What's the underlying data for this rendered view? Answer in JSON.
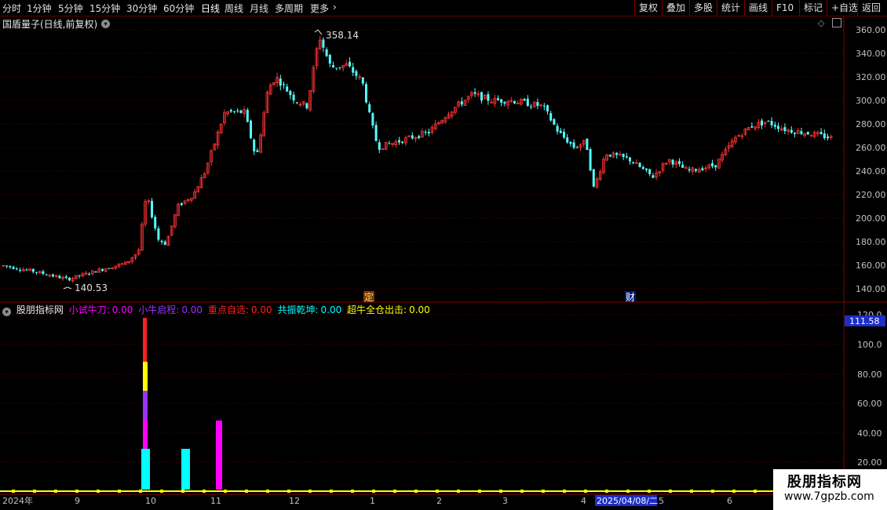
{
  "toolbar": {
    "periods": [
      "分时",
      "1分钟",
      "5分钟",
      "15分钟",
      "30分钟",
      "60分钟",
      "日线",
      "周线",
      "月线",
      "多周期",
      "更多"
    ],
    "active_period": "日线",
    "more_arrow": "›",
    "right_buttons": [
      "复权",
      "叠加",
      "多股",
      "统计",
      "画线",
      "F10",
      "标记",
      "+自选",
      "返回"
    ]
  },
  "stock": {
    "title": "国盾量子(日线,前复权)",
    "high_label": "358.14",
    "low_label": "140.53",
    "event_marks": [
      "定",
      "财"
    ]
  },
  "price_axis": {
    "ticks": [
      "360.00",
      "340.00",
      "320.00",
      "300.00",
      "280.00",
      "260.00",
      "240.00",
      "220.00",
      "200.00",
      "180.00",
      "160.00",
      "140.00"
    ]
  },
  "indicator": {
    "name": "股朋指标网",
    "items": [
      {
        "label": "小试牛刀:",
        "value": "0.00",
        "color": "#ff00ff"
      },
      {
        "label": "小牛启程:",
        "value": "0.00",
        "color": "#9932ff"
      },
      {
        "label": "重点自选:",
        "value": "0.00",
        "color": "#ff2020"
      },
      {
        "label": "共振乾坤:",
        "value": "0.00",
        "color": "#00ffff"
      },
      {
        "label": "超牛全仓出击:",
        "value": "0.00",
        "color": "#ffff00"
      }
    ],
    "axis_ticks": [
      "120.0",
      "100.0",
      "80.00",
      "60.00",
      "40.00",
      "20.00"
    ],
    "cursor_value": "111.58"
  },
  "date_axis": {
    "labels": [
      "2024年",
      "9",
      "10",
      "11",
      "12",
      "1",
      "2",
      "3",
      "4",
      "2025/04/08/二",
      "5",
      "6"
    ]
  },
  "watermark": {
    "title": "股朋指标网",
    "url": "www.7gpzb.com"
  },
  "colors": {
    "up": "#ff3232",
    "down": "#54ffff",
    "grid": "#6a0000",
    "frame": "#8a0000",
    "axis_text": "#c0c0c0"
  }
}
